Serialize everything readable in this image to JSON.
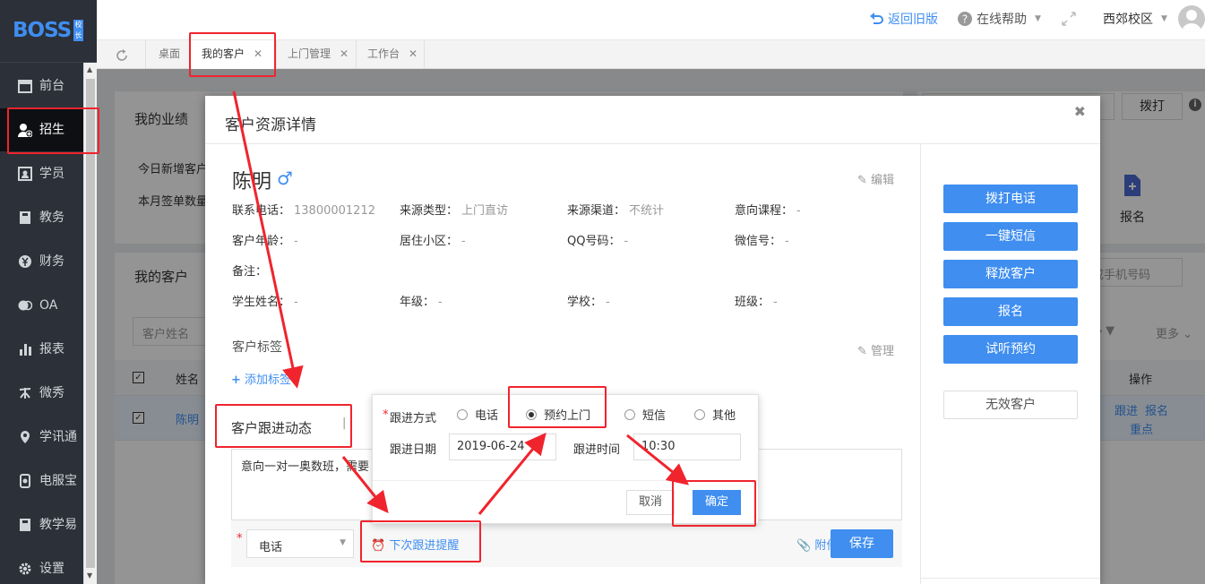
{
  "brand": {
    "logo_text": "BOSS",
    "logo_badge": "校长"
  },
  "sidebar": {
    "items": [
      {
        "label": "前台",
        "icon": "calendar-icon"
      },
      {
        "label": "招生",
        "icon": "add-user-icon",
        "active": true
      },
      {
        "label": "学员",
        "icon": "id-card-icon"
      },
      {
        "label": "教务",
        "icon": "book-icon"
      },
      {
        "label": "财务",
        "icon": "yen-icon"
      },
      {
        "label": "OA",
        "icon": "chat-icon"
      },
      {
        "label": "报表",
        "icon": "bar-chart-icon"
      },
      {
        "label": "微秀",
        "icon": "xiu-icon"
      },
      {
        "label": "学讯通",
        "icon": "location-icon"
      },
      {
        "label": "电服宝",
        "icon": "phone-icon"
      },
      {
        "label": "教学易",
        "icon": "book-icon"
      },
      {
        "label": "设置",
        "icon": "gear-icon"
      }
    ]
  },
  "topbar": {
    "back_old": "返回旧版",
    "help": "在线帮助",
    "campus": "西郊校区"
  },
  "tabs": [
    {
      "label": "桌面",
      "closable": false
    },
    {
      "label": "我的客户",
      "closable": true,
      "active": true
    },
    {
      "label": "上门管理",
      "closable": true
    },
    {
      "label": "工作台",
      "closable": true
    }
  ],
  "background": {
    "my_performance": "我的业绩",
    "today_new": "今日新增客户",
    "month_signed": "本月签单数量",
    "my_customers": "我的客户",
    "customer_name_ph": "客户姓名",
    "col_name": "姓名",
    "row_name": "陈明",
    "dial_button": "拨打",
    "signup": "报名",
    "phone_search_ph": "或手机号码",
    "more": "更多",
    "op_header": "操作",
    "op_follow": "跟进",
    "op_signup": "报名",
    "op_focus": "重点"
  },
  "modal": {
    "title": "客户资源详情",
    "customer_name": "陈明",
    "gender_symbol": "♂",
    "edit": "编辑",
    "fields": [
      {
        "label": "联系电话：",
        "value": "13800001212"
      },
      {
        "label": "来源类型：",
        "value": "上门直访"
      },
      {
        "label": "来源渠道：",
        "value": "不统计"
      },
      {
        "label": "意向课程：",
        "value": "-"
      },
      {
        "label": "客户年龄：",
        "value": "-"
      },
      {
        "label": "居住小区：",
        "value": "-"
      },
      {
        "label": "QQ号码：",
        "value": "-"
      },
      {
        "label": "微信号：",
        "value": "-"
      },
      {
        "label": "备注：",
        "value": "-"
      },
      {
        "label": "学生姓名：",
        "value": "-"
      },
      {
        "label": "年级：",
        "value": "-"
      },
      {
        "label": "学校：",
        "value": "-"
      },
      {
        "label": "班级：",
        "value": "-"
      }
    ],
    "tags_title": "客户标签",
    "manage": "管理",
    "add_tag": "添加标签",
    "follow_tab": "客户跟进动态",
    "follow_text": "意向一对一奥数班，需要",
    "follow_method_value": "电话",
    "next_reminder": "下次跟进提醒",
    "attachment": "附件",
    "save": "保存",
    "actions": [
      "拨打电话",
      "一键短信",
      "释放客户",
      "报名",
      "试听预约"
    ],
    "invalid": "无效客户"
  },
  "popover": {
    "method_label": "跟进方式",
    "options": [
      "电话",
      "预约上门",
      "短信",
      "其他"
    ],
    "selected": "预约上门",
    "date_label": "跟进日期",
    "date_value": "2019-06-24",
    "time_label": "跟进时间",
    "time_value": "10:30",
    "cancel": "取消",
    "confirm": "确定"
  },
  "colors": {
    "accent": "#3f8ef0",
    "sidebar": "#2c3038",
    "annotation": "#f0242d"
  }
}
